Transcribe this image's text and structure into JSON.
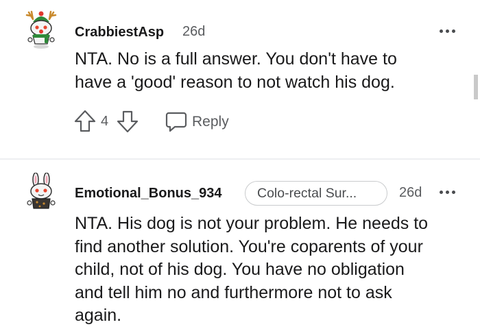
{
  "comments": [
    {
      "username": "CrabbiestAsp",
      "time": "26d",
      "body": [
        "NTA. No is a full answer. You don't have to",
        "have a 'good' reason to not watch his dog."
      ],
      "score": "4",
      "reply_label": "Reply",
      "avatar_icon": "snoo-reindeer-avatar-icon"
    },
    {
      "username": "Emotional_Bonus_934",
      "flair": "Colo-rectal Sur...",
      "time": "26d",
      "body": [
        "NTA. His dog is not your problem. He needs to",
        "find another solution. You're coparents of your",
        "child, not of his dog. You have no obligation",
        "and tell him no and furthermore not to ask",
        "again."
      ],
      "avatar_icon": "snoo-bunny-avatar-icon"
    }
  ],
  "colors": {
    "text": "#1a1a1b",
    "meta": "#5a5c5f",
    "divider": "#edeff1"
  }
}
